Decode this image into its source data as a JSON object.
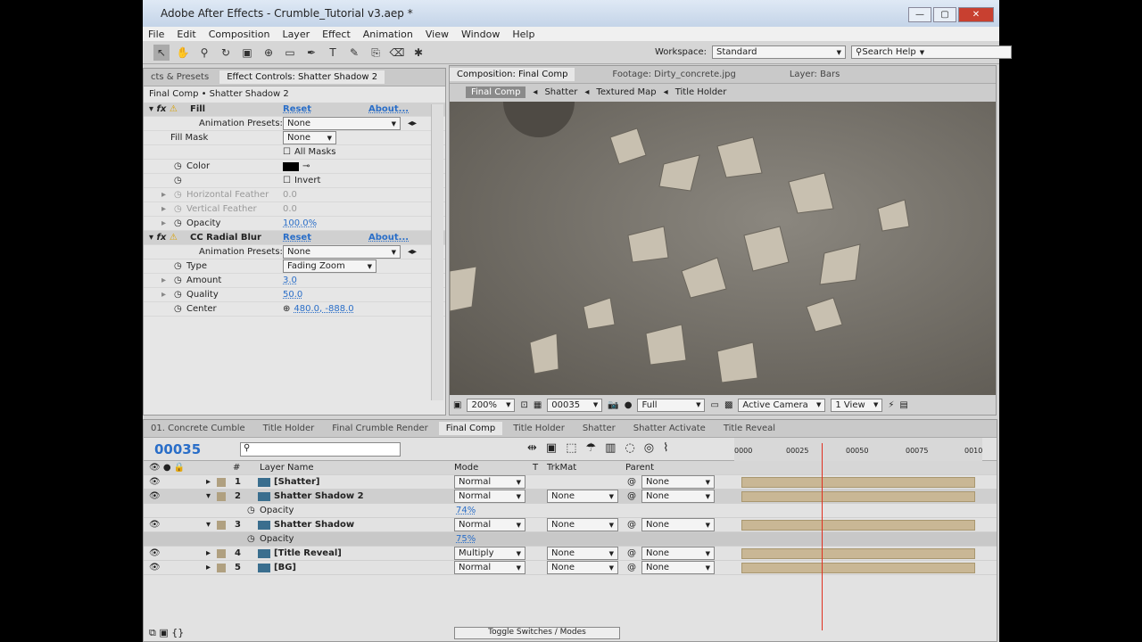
{
  "window": {
    "title": "Adobe After Effects - Crumble_Tutorial v3.aep *",
    "controls": [
      "—",
      "▢",
      "✕"
    ]
  },
  "menu": [
    "File",
    "Edit",
    "Composition",
    "Layer",
    "Effect",
    "Animation",
    "View",
    "Window",
    "Help"
  ],
  "toolbar": {
    "workspace_label": "Workspace:",
    "workspace": "Standard",
    "search_placeholder": "Search Help"
  },
  "effect_panel": {
    "tab_left": "cts & Presets",
    "tab": "Effect Controls: Shatter Shadow 2",
    "breadcrumb": "Final Comp • Shatter Shadow 2",
    "rows": [
      {
        "label": "Fill",
        "type": "fx",
        "reset": "Reset",
        "about": "About..."
      },
      {
        "label": "Animation Presets:",
        "value": "None",
        "type": "preset"
      },
      {
        "label": "Fill Mask",
        "value": "None",
        "type": "select"
      },
      {
        "label": "",
        "value": "All Masks",
        "type": "check"
      },
      {
        "label": "Color",
        "value": "",
        "type": "color"
      },
      {
        "label": "",
        "value": "Invert",
        "type": "check"
      },
      {
        "label": "Horizontal Feather",
        "value": "0.0",
        "type": "dim"
      },
      {
        "label": "Vertical Feather",
        "value": "0.0",
        "type": "dim"
      },
      {
        "label": "Opacity",
        "value": "100.0%",
        "type": "num"
      },
      {
        "label": "CC Radial Blur",
        "type": "fx",
        "reset": "Reset",
        "about": "About..."
      },
      {
        "label": "Animation Presets:",
        "value": "None",
        "type": "preset"
      },
      {
        "label": "Type",
        "value": "Fading Zoom",
        "type": "select"
      },
      {
        "label": "Amount",
        "value": "3.0",
        "type": "num"
      },
      {
        "label": "Quality",
        "value": "50.0",
        "type": "num"
      },
      {
        "label": "Center",
        "value": "480.0, -888.0",
        "type": "num"
      }
    ]
  },
  "comp_panel": {
    "tabs": [
      "Composition: Final Comp",
      "Footage: Dirty_concrete.jpg",
      "Layer: Bars"
    ],
    "flow": [
      "Final Comp",
      "Shatter",
      "Textured Map",
      "Title Holder"
    ],
    "zoom": "200%",
    "timecode": "00035",
    "resolution": "Full",
    "camera": "Active Camera",
    "views": "1 View"
  },
  "timeline": {
    "tabs": [
      "01. Concrete Cumble",
      "Title Holder",
      "Final Crumble Render",
      "Final Comp",
      "Title Holder",
      "Shatter",
      "Shatter Activate",
      "Title Reveal"
    ],
    "timecode": "00035",
    "columns": {
      "num": "#",
      "name": "Layer Name",
      "mode": "Mode",
      "t": "T",
      "trkmat": "TrkMat",
      "parent": "Parent"
    },
    "ruler": [
      "0000",
      "00025",
      "00050",
      "00075",
      "0010"
    ],
    "layers": [
      {
        "num": "1",
        "name": "[Shatter]",
        "mode": "Normal",
        "trkmat": "",
        "parent": "None"
      },
      {
        "num": "2",
        "name": "Shatter Shadow 2",
        "mode": "Normal",
        "trkmat": "None",
        "parent": "None",
        "prop": "Opacity",
        "prop_value": "74%"
      },
      {
        "num": "3",
        "name": "Shatter Shadow",
        "mode": "Normal",
        "trkmat": "None",
        "parent": "None",
        "prop": "Opacity",
        "prop_value": "75%"
      },
      {
        "num": "4",
        "name": "[Title Reveal]",
        "mode": "Multiply",
        "trkmat": "None",
        "parent": "None"
      },
      {
        "num": "5",
        "name": "[BG]",
        "mode": "Normal",
        "trkmat": "None",
        "parent": "None"
      }
    ],
    "toggle_label": "Toggle Switches / Modes"
  }
}
